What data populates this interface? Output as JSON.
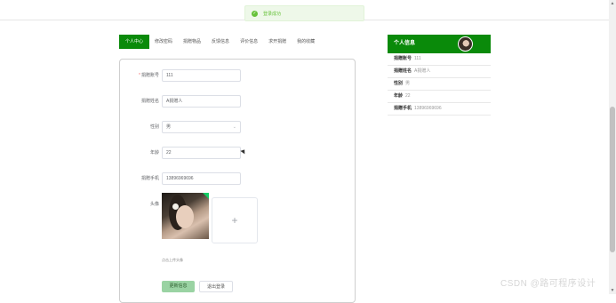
{
  "toast": {
    "icon": "check-circle-icon",
    "text": "登录成功"
  },
  "tabs": [
    "个人中心",
    "修改密码",
    "捐赠物品",
    "反馈信息",
    "评价信息",
    "求开捐赠",
    "我的收藏"
  ],
  "form": {
    "fields": [
      {
        "label": "捐赠账号",
        "value": "111",
        "required": true
      },
      {
        "label": "捐赠姓名",
        "value": "A捐赠人",
        "required": false
      },
      {
        "label": "性别",
        "value": "男",
        "required": false,
        "type": "select"
      },
      {
        "label": "年龄",
        "value": "22",
        "required": false
      },
      {
        "label": "捐赠手机",
        "value": "13896969696",
        "required": false
      }
    ],
    "avatar_label": "头像",
    "upload_plus": "+",
    "upload_hint": "点击上传头像",
    "update_button": "更新信息",
    "logout_button": "退出登录"
  },
  "side": {
    "title": "个人信息",
    "rows": [
      {
        "key": "捐赠账号",
        "value": "111"
      },
      {
        "key": "捐赠姓名",
        "value": "A捐赠人"
      },
      {
        "key": "性别",
        "value": "男"
      },
      {
        "key": "年龄",
        "value": "22"
      },
      {
        "key": "捐赠手机",
        "value": "13896969696"
      }
    ]
  },
  "watermark": "CSDN @路可程序设计",
  "colors": {
    "primary": "#0a8a0a",
    "success": "#67c23a",
    "button_light": "#9ad3a3"
  }
}
